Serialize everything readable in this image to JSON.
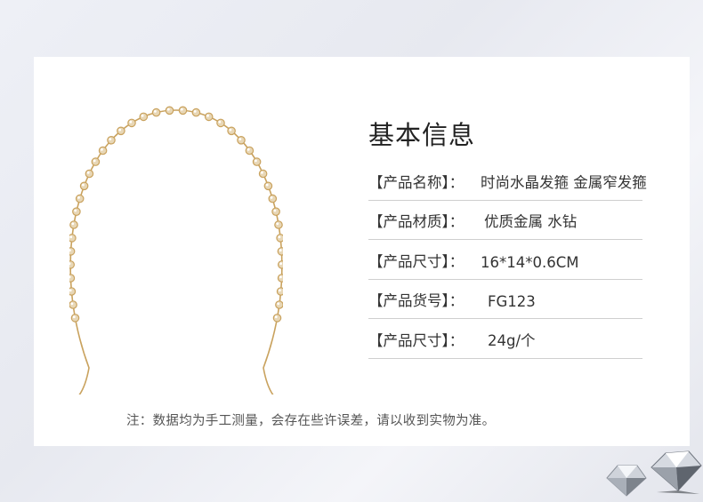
{
  "info": {
    "title": "基本信息",
    "rows": [
      {
        "label": "【产品名称】：",
        "value": "时尚水晶发箍 金属窄发箍"
      },
      {
        "label": "【产品材质】：",
        "value": "优质金属 水钻"
      },
      {
        "label": "【产品尺寸】：",
        "value": "16*14*0.6CM"
      },
      {
        "label": "【产品货号】：",
        "value": "FG123"
      },
      {
        "label": "【产品尺寸】：",
        "value": "24g/个"
      }
    ]
  },
  "note": "注：数据均为手工测量，会存在些许误差，请以收到实物为准。",
  "colors": {
    "gold": "#c9a25e",
    "rhinestone": "#e8d7b6",
    "divider": "#cfcfcf"
  },
  "images": {
    "product": "crystal-headband",
    "decor": "diamond-gems"
  }
}
